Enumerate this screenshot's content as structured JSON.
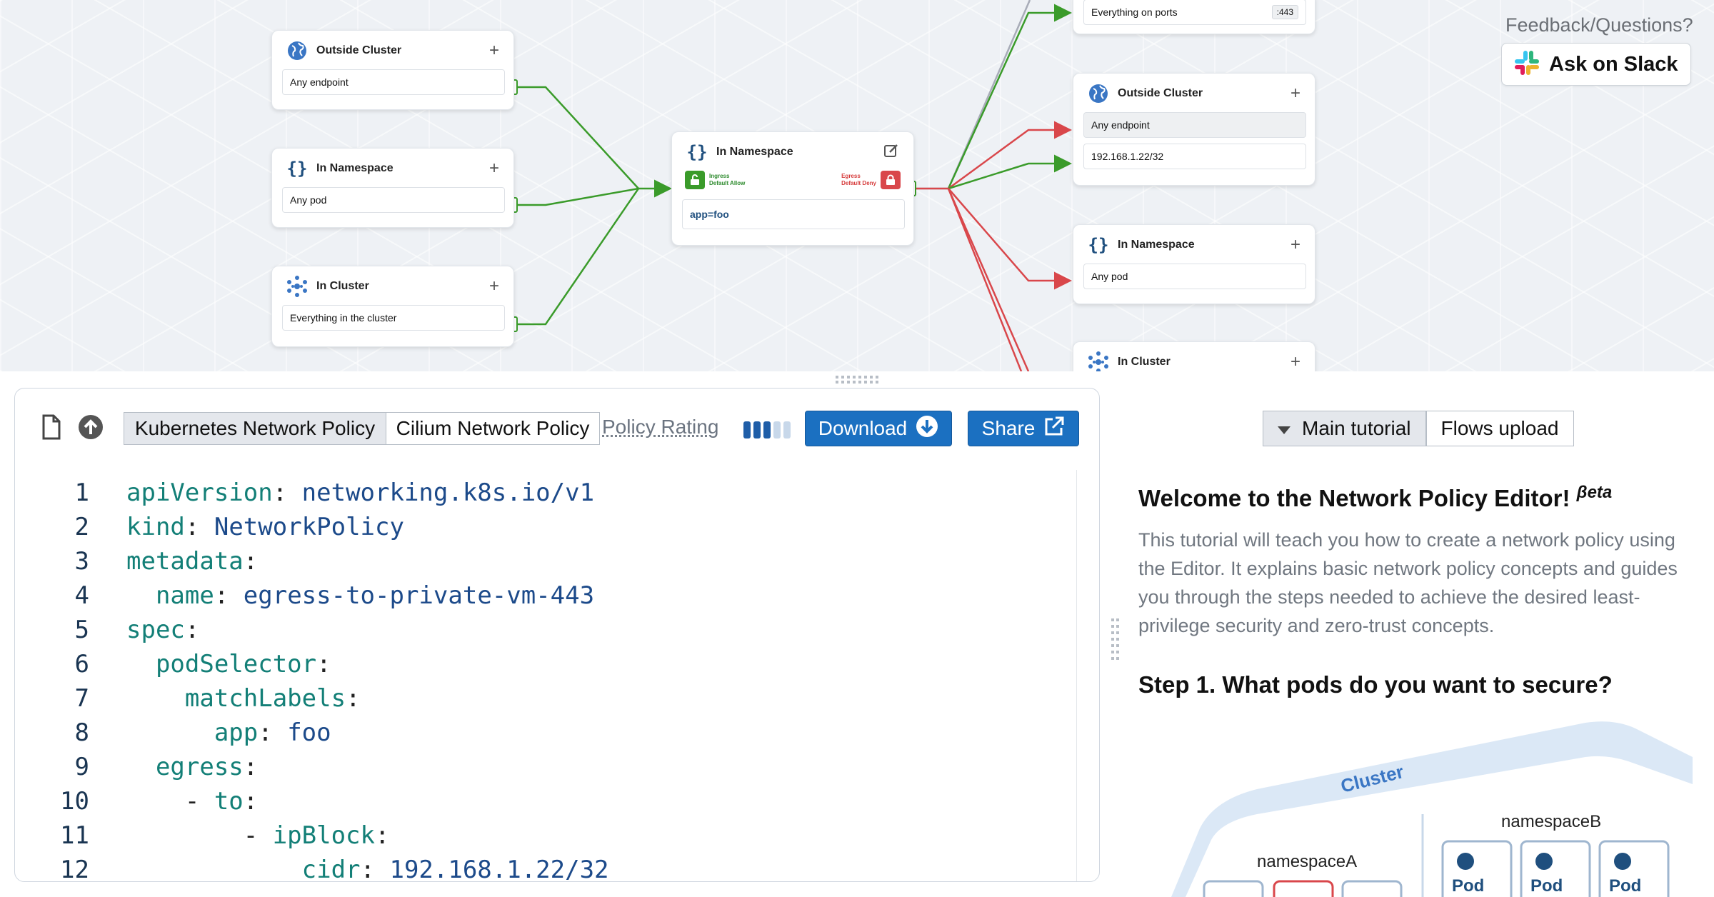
{
  "graph": {
    "ingress_cards": [
      {
        "title": "Outside Cluster",
        "icon": "globe-icon",
        "field": "Any endpoint"
      },
      {
        "title": "In Namespace",
        "icon": "braces-icon",
        "field": "Any pod"
      },
      {
        "title": "In Cluster",
        "icon": "cluster-icon",
        "field": "Everything in the cluster"
      }
    ],
    "policy_card": {
      "title": "In Namespace",
      "ingress_label": "Ingress",
      "ingress_status": "Default Allow",
      "egress_label": "Egress",
      "egress_status": "Default Deny",
      "selector": "app=foo"
    },
    "egress_cards": [
      {
        "field": "Everything on ports",
        "port": ":443"
      },
      {
        "title": "Outside Cluster",
        "icon": "globe-icon",
        "fields": [
          "Any endpoint",
          "192.168.1.22/32"
        ]
      },
      {
        "title": "In Namespace",
        "icon": "braces-icon",
        "field": "Any pod"
      },
      {
        "title": "In Cluster",
        "icon": "cluster-icon"
      }
    ],
    "edge_colors": {
      "allow": "#3a9b2a",
      "deny": "#d9474b"
    }
  },
  "feedback": {
    "text": "Feedback/Questions?",
    "slack_label": "Ask on Slack"
  },
  "editor": {
    "tabs": [
      "Kubernetes Network Policy",
      "Cilium Network Policy"
    ],
    "active_tab": "Kubernetes Network Policy",
    "rating_label": "Policy Rating",
    "rating_level": 3,
    "rating_max": 5,
    "download_label": "Download",
    "share_label": "Share",
    "lines": [
      {
        "n": "1",
        "indent": "",
        "key": "apiVersion",
        "value": "networking.k8s.io/v1"
      },
      {
        "n": "2",
        "indent": "",
        "key": "kind",
        "value": "NetworkPolicy"
      },
      {
        "n": "3",
        "indent": "",
        "key": "metadata",
        "value": ""
      },
      {
        "n": "4",
        "indent": "  ",
        "key": "name",
        "value": "egress-to-private-vm-443"
      },
      {
        "n": "5",
        "indent": "",
        "key": "spec",
        "value": ""
      },
      {
        "n": "6",
        "indent": "  ",
        "key": "podSelector",
        "value": ""
      },
      {
        "n": "7",
        "indent": "    ",
        "key": "matchLabels",
        "value": ""
      },
      {
        "n": "8",
        "indent": "      ",
        "key": "app",
        "value": "foo"
      },
      {
        "n": "9",
        "indent": "  ",
        "key": "egress",
        "value": ""
      },
      {
        "n": "10",
        "indent": "    - ",
        "key": "to",
        "value": ""
      },
      {
        "n": "11",
        "indent": "        - ",
        "key": "ipBlock",
        "value": ""
      },
      {
        "n": "12",
        "indent": "            ",
        "key": "cidr",
        "value": "192.168.1.22/32"
      }
    ]
  },
  "tutorial": {
    "tabs": [
      "Main tutorial",
      "Flows upload"
    ],
    "active_tab": "Main tutorial",
    "title": "Welcome to the Network Policy Editor!",
    "title_sup": "βeta",
    "intro": "This tutorial will teach you how to create a network policy using the Editor. It explains basic network policy concepts and guides you through the steps needed to achieve the desired least- privilege security and zero-trust concepts.",
    "step1": "Step 1. What pods do you want to secure?",
    "illustration": {
      "cluster_label": "Cluster",
      "namespace_a": "namespaceA",
      "namespace_b": "namespaceB",
      "pod_label": "Pod"
    }
  }
}
